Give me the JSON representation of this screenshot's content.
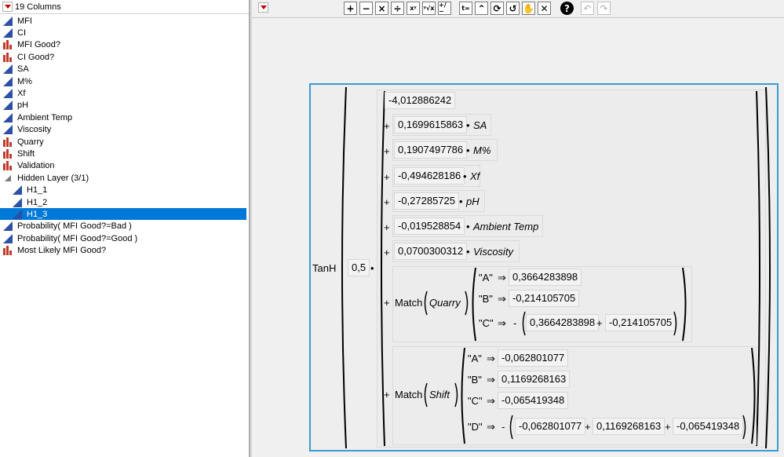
{
  "columns_panel": {
    "header": "19 Columns",
    "items": [
      {
        "label": "MFI",
        "type": "continuous"
      },
      {
        "label": "CI",
        "type": "continuous"
      },
      {
        "label": "MFI Good?",
        "type": "nominal"
      },
      {
        "label": "CI Good?",
        "type": "nominal"
      },
      {
        "label": "SA",
        "type": "continuous"
      },
      {
        "label": "M%",
        "type": "continuous"
      },
      {
        "label": "Xf",
        "type": "continuous"
      },
      {
        "label": "pH",
        "type": "continuous"
      },
      {
        "label": "Ambient Temp",
        "type": "continuous"
      },
      {
        "label": "Viscosity",
        "type": "continuous"
      },
      {
        "label": "Quarry",
        "type": "nominal"
      },
      {
        "label": "Shift",
        "type": "nominal"
      },
      {
        "label": "Validation",
        "type": "nominal"
      },
      {
        "label": "Hidden Layer (3/1)",
        "type": "group"
      },
      {
        "label": "H1_1",
        "type": "continuous"
      },
      {
        "label": "H1_2",
        "type": "continuous"
      },
      {
        "label": "H1_3",
        "type": "continuous"
      },
      {
        "label": "Probability( MFI Good?=Bad )",
        "type": "continuous"
      },
      {
        "label": "Probability( MFI Good?=Good )",
        "type": "continuous"
      },
      {
        "label": "Most Likely MFI Good?",
        "type": "nominal"
      }
    ]
  },
  "toolbar": {
    "buttons": [
      "+",
      "−",
      "×",
      "÷",
      "xʸ",
      "ʸ√x",
      "+/−",
      "t=",
      "⌃",
      "⟳",
      "↺",
      "✋",
      "✕",
      "?",
      "↶",
      "↷"
    ]
  },
  "colors": {
    "accent": "#3c9ad2",
    "selected": "#0078d7",
    "nominal_icon": "#c0392b",
    "continuous_icon": "#2c4fa8"
  },
  "formula": {
    "func": "TanH",
    "scale": "0,5",
    "dot": "•",
    "plus": "+",
    "minus": "-",
    "arrow": "⇒",
    "intercept": "-4,012886242",
    "terms": [
      {
        "coef": "0,1699615863",
        "var": "SA"
      },
      {
        "coef": "0,1907497786",
        "var": "M%"
      },
      {
        "coef": "-0,494628186",
        "var": "Xf"
      },
      {
        "coef": "-0,27285725",
        "var": "pH"
      },
      {
        "coef": "-0,019528854",
        "var": "Ambient Temp"
      },
      {
        "coef": "0,0700300312",
        "var": "Viscosity"
      }
    ],
    "match_label": "Match",
    "quarry": {
      "var": "Quarry",
      "a": {
        "key": "\"A\"",
        "val": "0,3664283898"
      },
      "b": {
        "key": "\"B\"",
        "val": "-0,214105705"
      },
      "c": {
        "key": "\"C\"",
        "v1": "0,3664283898",
        "v2": "-0,214105705"
      }
    },
    "shift": {
      "var": "Shift",
      "a": {
        "key": "\"A\"",
        "val": "-0,062801077"
      },
      "b": {
        "key": "\"B\"",
        "val": "0,1169268163"
      },
      "c": {
        "key": "\"C\"",
        "val": "-0,065419348"
      },
      "d": {
        "key": "\"D\"",
        "v1": "-0,062801077",
        "v2": "0,1169268163",
        "v3": "-0,065419348"
      }
    }
  }
}
